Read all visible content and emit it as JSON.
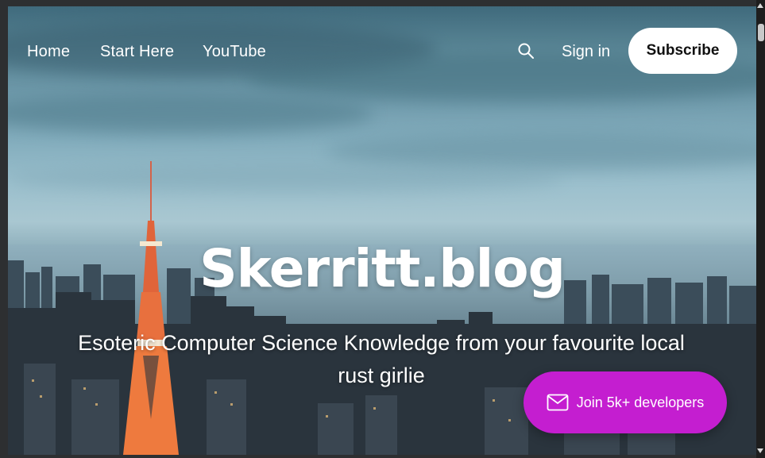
{
  "nav": {
    "links": [
      "Home",
      "Start Here",
      "YouTube"
    ],
    "search_icon": "search-icon",
    "signin_label": "Sign in",
    "subscribe_label": "Subscribe"
  },
  "hero": {
    "title": "Skerritt.blog",
    "description": "Esoteric Computer Science Knowledge from your favourite local rust girlie"
  },
  "portal": {
    "icon": "mail-icon",
    "label": "Join 5k+ developers",
    "color": "#c41ed0"
  }
}
